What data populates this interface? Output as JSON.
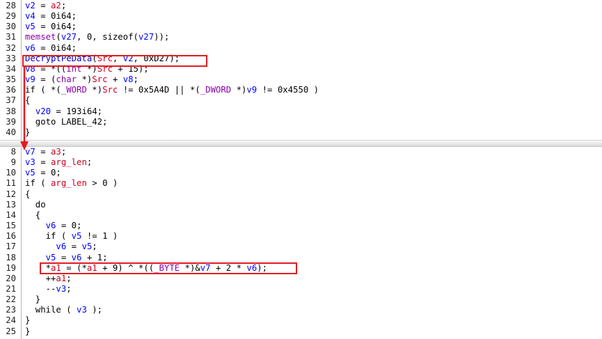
{
  "top_pane": {
    "lines": [
      {
        "num": "28",
        "tokens": [
          {
            "t": "v2",
            "c": "v"
          },
          {
            "t": " = ",
            "c": "n"
          },
          {
            "t": "a2",
            "c": "r"
          },
          {
            "t": ";",
            "c": "n"
          }
        ]
      },
      {
        "num": "29",
        "tokens": [
          {
            "t": "v4",
            "c": "v"
          },
          {
            "t": " = 0i64;",
            "c": "n"
          }
        ]
      },
      {
        "num": "30",
        "tokens": [
          {
            "t": "v5",
            "c": "v"
          },
          {
            "t": " = 0i64;",
            "c": "n"
          }
        ]
      },
      {
        "num": "31",
        "tokens": [
          {
            "t": "memset",
            "c": "t"
          },
          {
            "t": "(",
            "c": "n"
          },
          {
            "t": "v27",
            "c": "v"
          },
          {
            "t": ", 0, sizeof(",
            "c": "n"
          },
          {
            "t": "v27",
            "c": "v"
          },
          {
            "t": "));",
            "c": "n"
          }
        ]
      },
      {
        "num": "32",
        "tokens": [
          {
            "t": "v6",
            "c": "v"
          },
          {
            "t": " = 0i64;",
            "c": "n"
          }
        ]
      },
      {
        "num": "33",
        "tokens": [
          {
            "t": "DecryptPeData",
            "c": "k"
          },
          {
            "t": "(",
            "c": "n"
          },
          {
            "t": "Src",
            "c": "r"
          },
          {
            "t": ", ",
            "c": "n"
          },
          {
            "t": "v2",
            "c": "v"
          },
          {
            "t": ", 0xD27);",
            "c": "n"
          }
        ]
      },
      {
        "num": "34",
        "tokens": [
          {
            "t": "v8",
            "c": "v"
          },
          {
            "t": " = *((",
            "c": "n"
          },
          {
            "t": "int",
            "c": "t"
          },
          {
            "t": " *)",
            "c": "n"
          },
          {
            "t": "Src",
            "c": "r"
          },
          {
            "t": " + 15);",
            "c": "n"
          }
        ]
      },
      {
        "num": "35",
        "tokens": [
          {
            "t": "v9",
            "c": "v"
          },
          {
            "t": " = (",
            "c": "n"
          },
          {
            "t": "char",
            "c": "t"
          },
          {
            "t": " *)",
            "c": "n"
          },
          {
            "t": "Src",
            "c": "r"
          },
          {
            "t": " + ",
            "c": "n"
          },
          {
            "t": "v8",
            "c": "v"
          },
          {
            "t": ";",
            "c": "n"
          }
        ]
      },
      {
        "num": "36",
        "tokens": [
          {
            "t": "if ( *(",
            "c": "n"
          },
          {
            "t": "_WORD",
            "c": "t"
          },
          {
            "t": " *)",
            "c": "n"
          },
          {
            "t": "Src",
            "c": "r"
          },
          {
            "t": " != 0x5A4D || *(",
            "c": "n"
          },
          {
            "t": "_DWORD",
            "c": "t"
          },
          {
            "t": " *)",
            "c": "n"
          },
          {
            "t": "v9",
            "c": "v"
          },
          {
            "t": " != 0x4550 )",
            "c": "n"
          }
        ]
      },
      {
        "num": "37",
        "tokens": [
          {
            "t": "{",
            "c": "n"
          }
        ]
      },
      {
        "num": "38",
        "tokens": [
          {
            "t": "  ",
            "c": "n"
          },
          {
            "t": "v20",
            "c": "v"
          },
          {
            "t": " = 193i64;",
            "c": "n"
          }
        ]
      },
      {
        "num": "39",
        "tokens": [
          {
            "t": "  goto LABEL_42;",
            "c": "n"
          }
        ]
      },
      {
        "num": "40",
        "tokens": [
          {
            "t": "}",
            "c": "n"
          }
        ]
      }
    ]
  },
  "bottom_pane": {
    "lines": [
      {
        "num": "8",
        "tokens": [
          {
            "t": "v7",
            "c": "v"
          },
          {
            "t": " = ",
            "c": "n"
          },
          {
            "t": "a3",
            "c": "r"
          },
          {
            "t": ";",
            "c": "n"
          }
        ]
      },
      {
        "num": "9",
        "tokens": [
          {
            "t": "v3",
            "c": "v"
          },
          {
            "t": " = ",
            "c": "n"
          },
          {
            "t": "arg_len",
            "c": "r"
          },
          {
            "t": ";",
            "c": "n"
          }
        ]
      },
      {
        "num": "10",
        "tokens": [
          {
            "t": "v5",
            "c": "v"
          },
          {
            "t": " = 0;",
            "c": "n"
          }
        ]
      },
      {
        "num": "11",
        "tokens": [
          {
            "t": "if ( ",
            "c": "n"
          },
          {
            "t": "arg_len",
            "c": "r"
          },
          {
            "t": " > 0 )",
            "c": "n"
          }
        ]
      },
      {
        "num": "12",
        "tokens": [
          {
            "t": "{",
            "c": "n"
          }
        ]
      },
      {
        "num": "13",
        "tokens": [
          {
            "t": "  do",
            "c": "n"
          }
        ]
      },
      {
        "num": "14",
        "tokens": [
          {
            "t": "  {",
            "c": "n"
          }
        ]
      },
      {
        "num": "15",
        "tokens": [
          {
            "t": "    ",
            "c": "n"
          },
          {
            "t": "v6",
            "c": "v"
          },
          {
            "t": " = 0;",
            "c": "n"
          }
        ]
      },
      {
        "num": "16",
        "tokens": [
          {
            "t": "    if ( ",
            "c": "n"
          },
          {
            "t": "v5",
            "c": "v"
          },
          {
            "t": " != 1 )",
            "c": "n"
          }
        ]
      },
      {
        "num": "17",
        "tokens": [
          {
            "t": "      ",
            "c": "n"
          },
          {
            "t": "v6",
            "c": "v"
          },
          {
            "t": " = ",
            "c": "n"
          },
          {
            "t": "v5",
            "c": "v"
          },
          {
            "t": ";",
            "c": "n"
          }
        ]
      },
      {
        "num": "18",
        "tokens": [
          {
            "t": "    ",
            "c": "n"
          },
          {
            "t": "v5",
            "c": "v"
          },
          {
            "t": " = ",
            "c": "n"
          },
          {
            "t": "v6",
            "c": "v"
          },
          {
            "t": " + 1;",
            "c": "n"
          }
        ]
      },
      {
        "num": "19",
        "tokens": [
          {
            "t": "    *",
            "c": "n"
          },
          {
            "t": "a1",
            "c": "r"
          },
          {
            "t": " = (*",
            "c": "n"
          },
          {
            "t": "a1",
            "c": "r"
          },
          {
            "t": " + 9) ^ *((",
            "c": "n"
          },
          {
            "t": "_BYTE",
            "c": "t"
          },
          {
            "t": " *)&",
            "c": "n"
          },
          {
            "t": "v7",
            "c": "v"
          },
          {
            "t": " + 2 * ",
            "c": "n"
          },
          {
            "t": "v6",
            "c": "v"
          },
          {
            "t": ");",
            "c": "n"
          }
        ]
      },
      {
        "num": "20",
        "tokens": [
          {
            "t": "    ++",
            "c": "n"
          },
          {
            "t": "a1",
            "c": "r"
          },
          {
            "t": ";",
            "c": "n"
          }
        ]
      },
      {
        "num": "21",
        "tokens": [
          {
            "t": "    --",
            "c": "n"
          },
          {
            "t": "v3",
            "c": "v"
          },
          {
            "t": ";",
            "c": "n"
          }
        ]
      },
      {
        "num": "22",
        "tokens": [
          {
            "t": "  }",
            "c": "n"
          }
        ]
      },
      {
        "num": "23",
        "tokens": [
          {
            "t": "  while ( ",
            "c": "n"
          },
          {
            "t": "v3",
            "c": "v"
          },
          {
            "t": " );",
            "c": "n"
          }
        ]
      },
      {
        "num": "24",
        "tokens": [
          {
            "t": "}",
            "c": "n"
          }
        ]
      },
      {
        "num": "25",
        "tokens": [
          {
            "t": "}",
            "c": "n"
          }
        ]
      }
    ]
  },
  "colors": {
    "highlight": "#e11b22",
    "variable": "#0000ff",
    "argument": "#c8001e",
    "type": "#8a00a8",
    "function": "#0000c8",
    "text": "#000000"
  }
}
